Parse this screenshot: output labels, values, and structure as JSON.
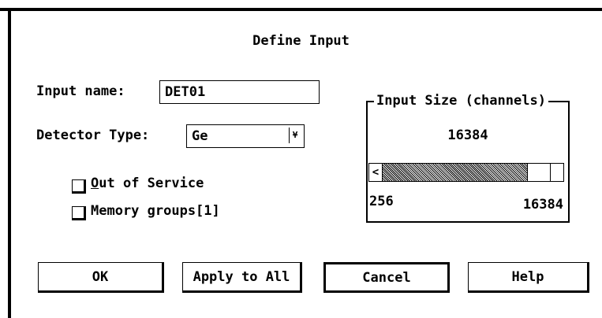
{
  "dialog": {
    "title": "Define Input",
    "input_name": {
      "label": "Input name:",
      "value": "DET01"
    },
    "detector_type": {
      "label": "Detector Type:",
      "value": "Ge",
      "arrow_glyph": "¥"
    },
    "checkboxes": [
      {
        "mnemonic": "O",
        "label_rest": "ut of Service",
        "checked": false
      },
      {
        "label": "Memory groups[1]",
        "checked": false
      }
    ],
    "input_size": {
      "group_title": "Input Size (channels)",
      "value": "16384",
      "min_label": "256",
      "max_label": "16384",
      "scroll_left_glyph": "<",
      "slider_min": 256,
      "slider_max": 16384,
      "slider_value": 16384
    },
    "buttons": {
      "ok": "OK",
      "apply_all": "Apply to All",
      "cancel": "Cancel",
      "help": "Help"
    }
  }
}
